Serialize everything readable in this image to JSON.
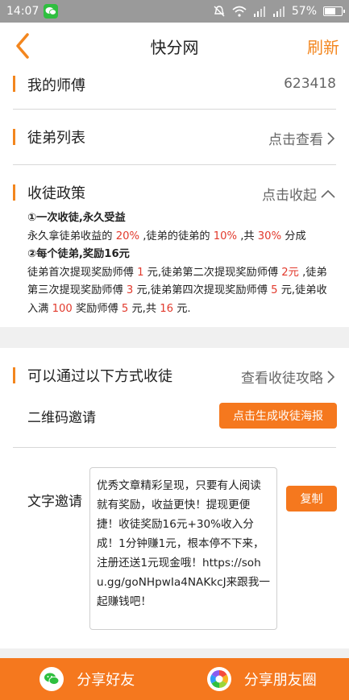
{
  "status_bar": {
    "time": "14:07",
    "battery": "57%",
    "battery_level": 0.57
  },
  "nav": {
    "title": "快分网",
    "refresh_label": "刷新"
  },
  "master": {
    "label": "我的师傅",
    "value": "623418"
  },
  "apprentices": {
    "label": "徒弟列表",
    "action": "点击查看"
  },
  "policy": {
    "label": "收徒政策",
    "action": "点击收起",
    "line1_heading": "①一次收徒,永久受益",
    "line2": {
      "a": "永久拿徒弟收益的 ",
      "p1": "20%",
      "b": " ,徒弟的徒弟的 ",
      "p2": "10%",
      "c": " ,共 ",
      "p3": "30%",
      "d": " 分成"
    },
    "line3_heading": "②每个徒弟,奖励16元",
    "detail": {
      "a": "徒弟首次提现奖励师傅 ",
      "v1": "1",
      "b": " 元,徒弟第二次提现奖励师傅 ",
      "v2": "2元",
      "c": " ,徒弟第三次提现奖励师傅 ",
      "v3": "3",
      "d": " 元,徒弟第四次提现奖励师傅 ",
      "v4": "5",
      "e": " 元,徒弟收入满 ",
      "v5": "100",
      "f": " 奖励师傅 ",
      "v6": "5",
      "g": " 元,共 ",
      "v7": "16",
      "h": " 元."
    }
  },
  "methods": {
    "label": "可以通过以下方式收徒",
    "action": "查看收徒攻略"
  },
  "qr": {
    "label": "二维码邀请",
    "button": "点击生成收徒海报"
  },
  "text_invite": {
    "label": "文字邀请",
    "button": "复制",
    "content": "优秀文章精彩呈现，只要有人阅读就有奖励，收益更快！提现更便捷！收徒奖励16元+30%收入分成！1分钟赚1元，根本停不下来，注册还送1元现金哦！https://sohu.gg/goNHpwIa4NAKkcJ来跟我一起赚钱吧！"
  },
  "bottom": {
    "share_friends": "分享好友",
    "share_moments": "分享朋友圈"
  },
  "colors": {
    "accent": "#f3861e",
    "button": "#f5781e",
    "highlight": "#e23a2d",
    "wechat": "#2fbf3f"
  }
}
